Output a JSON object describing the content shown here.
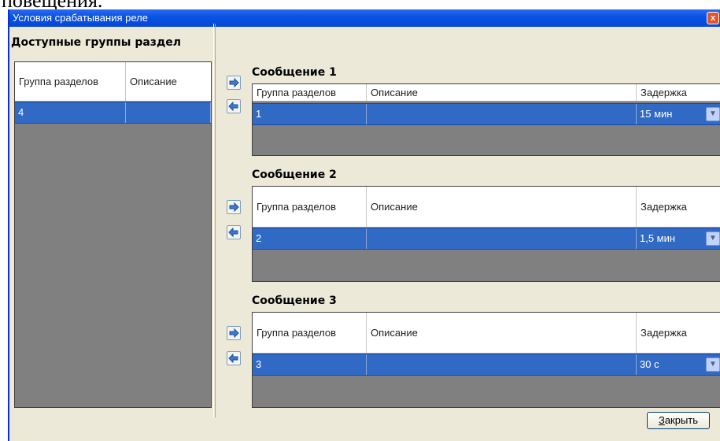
{
  "doc_fragment": "повещения.",
  "window": {
    "title": "Условия срабатывания реле",
    "close_glyph": "x"
  },
  "available": {
    "title": "Доступные группы раздел",
    "headers": [
      "Группа разделов",
      "Описание"
    ],
    "rows": [
      {
        "group": "4",
        "description": ""
      }
    ]
  },
  "messages": [
    {
      "title": "Сообщение 1",
      "headers": [
        "Группа разделов",
        "Описание",
        "Задержка"
      ],
      "rows": [
        {
          "group": "1",
          "description": "",
          "delay": "15 мин"
        }
      ]
    },
    {
      "title": "Сообщение 2",
      "headers": [
        "Группа разделов",
        "Описание",
        "Задержка"
      ],
      "rows": [
        {
          "group": "2",
          "description": "",
          "delay": "1,5 мин"
        }
      ]
    },
    {
      "title": "Сообщение 3",
      "headers": [
        "Группа разделов",
        "Описание",
        "Задержка"
      ],
      "rows": [
        {
          "group": "3",
          "description": "",
          "delay": "30 с"
        }
      ]
    }
  ],
  "footer": {
    "close_label_underlined": "З",
    "close_label_rest": "акрыть"
  },
  "colors": {
    "selection": "#316ac5",
    "grid_background": "#808080",
    "dialog_background": "#ece9d8",
    "titlebar": "#0a54e3"
  },
  "icons": {
    "move_right": "arrow-right-icon",
    "move_left": "arrow-left-icon",
    "dropdown": "chevron-down-icon"
  }
}
